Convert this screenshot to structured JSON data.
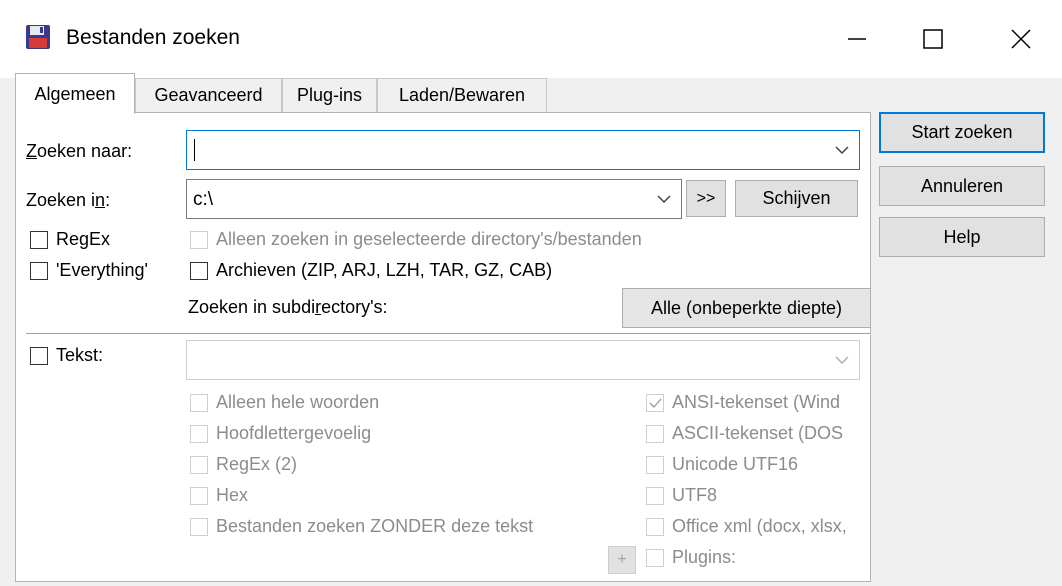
{
  "window": {
    "title": "Bestanden zoeken"
  },
  "tabs": [
    "Algemeen",
    "Geavanceerd",
    "Plug-ins",
    "Laden/Bewaren"
  ],
  "search_for": {
    "label_u": "Z",
    "label_rest": "oeken naar:",
    "value": ""
  },
  "search_in": {
    "label_pre": "Zoeken i",
    "label_u": "n",
    "label_post": ":",
    "value": "c:\\",
    "browse_label": ">>",
    "drives_label": "Schijven"
  },
  "options": {
    "regex": "RegEx",
    "everything": "'Everything'",
    "selected_only": "Alleen zoeken in geselecteerde directory's/bestanden",
    "archives": "Archieven (ZIP, ARJ, LZH, TAR, GZ, CAB)",
    "subdirs_pre": "Zoeken in subdi",
    "subdirs_u": "r",
    "subdirs_post": "ectory's:",
    "subdirs_value": "Alle (onbeperkte diepte)"
  },
  "text": {
    "label": "Tekst:",
    "value": "",
    "left_options": [
      "Alleen hele woorden",
      "Hoofdlettergevoelig",
      "RegEx (2)",
      "Hex",
      "Bestanden zoeken ZONDER deze tekst"
    ],
    "right_options": [
      "ANSI-tekenset (Wind",
      "ASCII-tekenset (DOS",
      "Unicode UTF16",
      "UTF8",
      "Office xml (docx, xlsx,",
      "Plugins:"
    ],
    "ansi_checked": true,
    "plus": "+"
  },
  "buttons": {
    "start": "Start zoeken",
    "cancel": "Annuleren",
    "help": "Help"
  },
  "colors": {
    "accent": "#0078d7",
    "disabled": "#8c8c8c"
  }
}
